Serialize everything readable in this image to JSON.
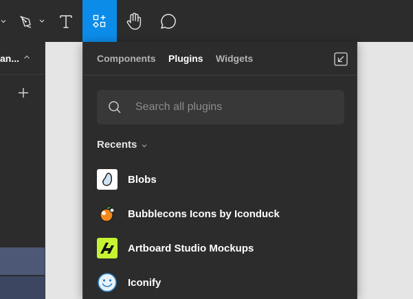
{
  "toolbar": {
    "tools": [
      "pen-tool",
      "text-tool",
      "resources-tool",
      "hand-tool",
      "comment-tool"
    ],
    "active_tool": "resources-tool",
    "accent": "#0c8ce9"
  },
  "left_panel": {
    "page_name": "an...",
    "add_icon": "plus-icon"
  },
  "resources": {
    "tabs": [
      {
        "label": "Components"
      },
      {
        "label": "Plugins"
      },
      {
        "label": "Widgets"
      }
    ],
    "active_tab": "Plugins",
    "search": {
      "placeholder": "Search all plugins",
      "value": ""
    },
    "section_title": "Recents",
    "plugins": [
      {
        "label": "Blobs",
        "icon": "blobs-icon"
      },
      {
        "label": "Bubblecons Icons by Iconduck",
        "icon": "bubblecons-icon"
      },
      {
        "label": "Artboard Studio Mockups",
        "icon": "artboard-studio-icon"
      },
      {
        "label": "Iconify",
        "icon": "iconify-icon"
      }
    ]
  },
  "colors": {
    "panel_bg": "#2c2c2c",
    "canvas_bg": "#e5e5e5",
    "accent": "#0c8ce9",
    "selection": "#4c5876"
  }
}
